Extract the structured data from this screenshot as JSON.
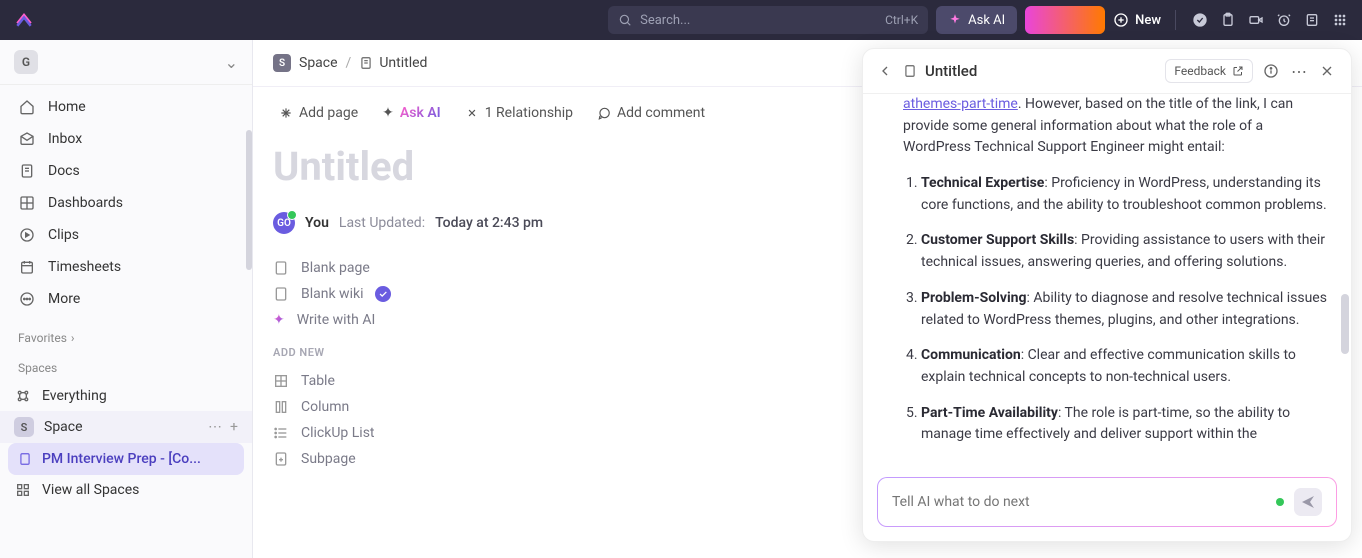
{
  "topbar": {
    "search_placeholder": "Search...",
    "search_shortcut": "Ctrl+K",
    "ask_ai": "Ask AI",
    "new": "New"
  },
  "workspace": {
    "initial": "G",
    "name": " "
  },
  "sidebar": {
    "items": [
      {
        "label": "Home"
      },
      {
        "label": "Inbox"
      },
      {
        "label": "Docs"
      },
      {
        "label": "Dashboards"
      },
      {
        "label": "Clips"
      },
      {
        "label": "Timesheets"
      },
      {
        "label": "More"
      }
    ],
    "favorites_label": "Favorites",
    "spaces_label": "Spaces",
    "everything": "Everything",
    "space_name": "Space",
    "space_initial": "S",
    "selected_doc": "PM Interview Prep - [Co...",
    "view_all": "View all Spaces"
  },
  "breadcrumb": {
    "space_initial": "S",
    "space": "Space",
    "title": "Untitled"
  },
  "doc": {
    "add_page": "Add page",
    "ask_ai": "Ask AI",
    "relationship": "1 Relationship",
    "add_comment": "Add comment",
    "title": "Untitled",
    "avatar": "GO",
    "you": "You",
    "last_updated_label": "Last Updated:",
    "last_updated_value": "Today at 2:43 pm",
    "options": [
      "Blank page",
      "Blank wiki",
      "Write with AI"
    ],
    "add_new_label": "ADD NEW",
    "add_new_items": [
      "Table",
      "Column",
      "ClickUp List",
      "Subpage"
    ]
  },
  "ai_panel": {
    "title": "Untitled",
    "feedback": "Feedback",
    "intro_link": "athemes-part-time",
    "intro_text": ". However, based on the title of the link, I can provide some general information about what the role of a WordPress Technical Support Engineer might entail:",
    "items": [
      {
        "title": "Technical Expertise",
        "body": ": Proficiency in WordPress, understanding its core functions, and the ability to troubleshoot common problems."
      },
      {
        "title": "Customer Support Skills",
        "body": ": Providing assistance to users with their technical issues, answering queries, and offering solutions."
      },
      {
        "title": "Problem-Solving",
        "body": ": Ability to diagnose and resolve technical issues related to WordPress themes, plugins, and other integrations."
      },
      {
        "title": "Communication",
        "body": ": Clear and effective communication skills to explain technical concepts to non-technical users."
      },
      {
        "title": "Part-Time Availability",
        "body": ": The role is part-time, so the ability to manage time effectively and deliver support within the"
      }
    ],
    "input_placeholder": "Tell AI what to do next"
  }
}
